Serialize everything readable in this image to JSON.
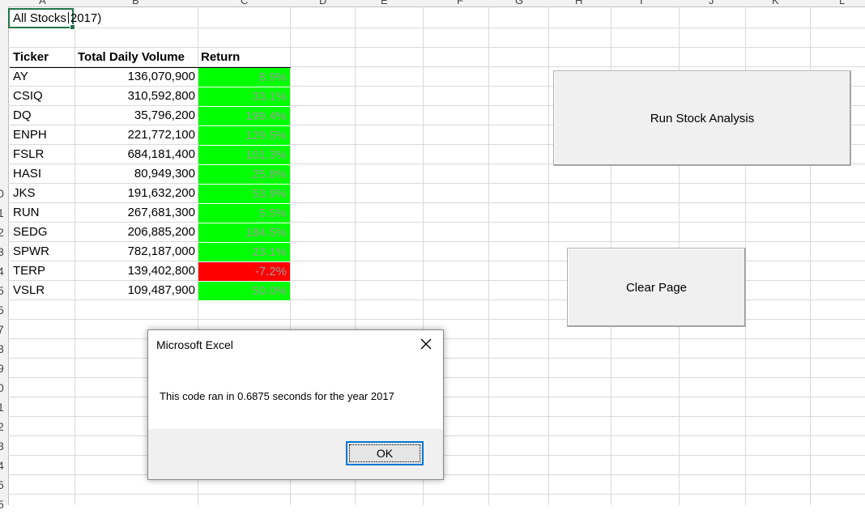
{
  "column_headers": [
    "A",
    "B",
    "C",
    "D",
    "E",
    "F",
    "G",
    "H",
    "I",
    "J",
    "K",
    "L"
  ],
  "row_numbers": [
    "0",
    "1",
    "2",
    "3",
    "4",
    "5",
    "5",
    "7",
    "3",
    "9",
    "0",
    "1",
    "2",
    "3",
    "4",
    "5",
    "5"
  ],
  "sheet": {
    "title_cell": "All Stocks",
    "title_rest": "2017)",
    "headers": {
      "ticker": "Ticker",
      "volume": "Total Daily Volume",
      "return": "Return"
    },
    "rows": [
      {
        "ticker": "AY",
        "volume": "136,070,900",
        "return": "8.9%",
        "status": "positive"
      },
      {
        "ticker": "CSIQ",
        "volume": "310,592,800",
        "return": "33.1%",
        "status": "positive"
      },
      {
        "ticker": "DQ",
        "volume": "35,796,200",
        "return": "199.4%",
        "status": "positive"
      },
      {
        "ticker": "ENPH",
        "volume": "221,772,100",
        "return": "129.5%",
        "status": "positive"
      },
      {
        "ticker": "FSLR",
        "volume": "684,181,400",
        "return": "101.3%",
        "status": "positive"
      },
      {
        "ticker": "HASI",
        "volume": "80,949,300",
        "return": "25.8%",
        "status": "positive"
      },
      {
        "ticker": "JKS",
        "volume": "191,632,200",
        "return": "53.9%",
        "status": "positive"
      },
      {
        "ticker": "RUN",
        "volume": "267,681,300",
        "return": "5.5%",
        "status": "positive"
      },
      {
        "ticker": "SEDG",
        "volume": "206,885,200",
        "return": "184.5%",
        "status": "positive"
      },
      {
        "ticker": "SPWR",
        "volume": "782,187,000",
        "return": "23.1%",
        "status": "positive"
      },
      {
        "ticker": "TERP",
        "volume": "139,402,800",
        "return": "-7.2%",
        "status": "negative"
      },
      {
        "ticker": "VSLR",
        "volume": "109,487,900",
        "return": "50.0%",
        "status": "positive"
      }
    ]
  },
  "colors": {
    "positive": "#00ff00",
    "negative": "#ff0000",
    "selection": "#217346",
    "focus": "#0078d7"
  },
  "buttons": {
    "run_analysis": "Run Stock Analysis",
    "clear_page": "Clear Page"
  },
  "dialog": {
    "title": "Microsoft Excel",
    "message": "This code ran in 0.6875 seconds for the year 2017",
    "ok_label": "OK",
    "close_icon": "close-icon"
  }
}
